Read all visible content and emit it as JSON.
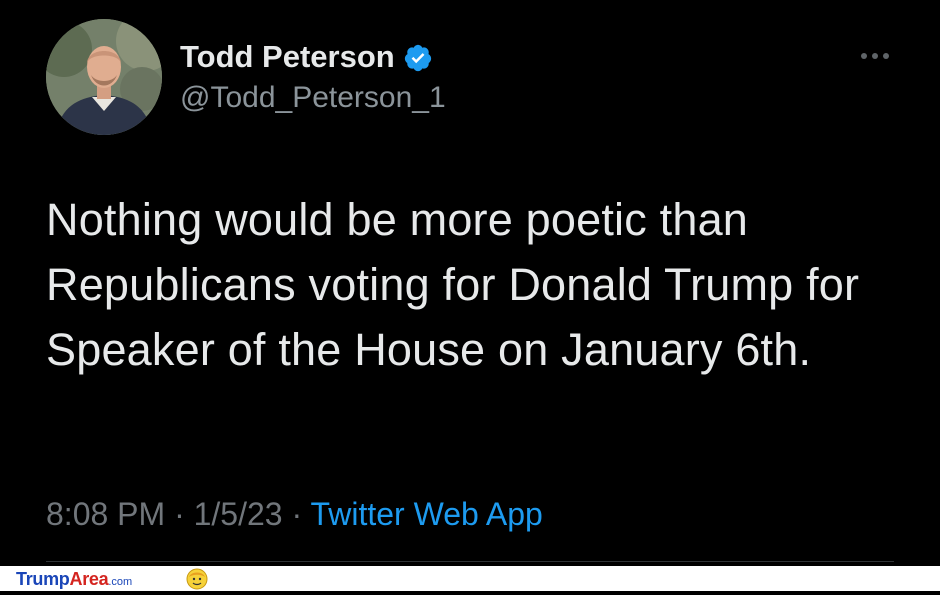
{
  "tweet": {
    "display_name": "Todd Peterson",
    "handle": "@Todd_Peterson_1",
    "verified_icon": "verified-badge-icon",
    "more_icon": "more-options-icon",
    "text": "Nothing would be more poetic than Republicans voting for Donald Trump for Speaker of the House on January 6th.",
    "time": "8:08 PM",
    "separator": "·",
    "date": "1/5/23",
    "source": "Twitter Web App"
  },
  "watermark": {
    "trump": "Trump",
    "area": "Area",
    "com": ".com"
  },
  "colors": {
    "background": "#000000",
    "primary_text": "#e7e9ea",
    "secondary_text": "#71767b",
    "link": "#1d9bf0",
    "verified": "#1d9bf0"
  }
}
